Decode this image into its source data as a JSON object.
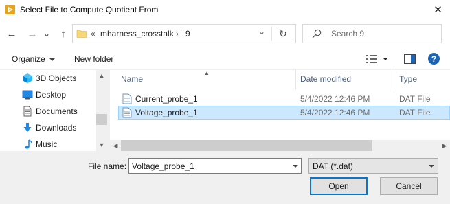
{
  "window": {
    "title": "Select File to Compute Quotient From",
    "close_glyph": "✕",
    "app_icon": "app-logo-icon"
  },
  "navigation": {
    "back_glyph": "←",
    "forward_glyph": "→",
    "recent_glyph": "⌄",
    "up_glyph": "↑",
    "breadcrumb_overflow": "«",
    "breadcrumb": [
      "mharness_crosstalk",
      "9"
    ],
    "breadcrumb_separator": "›",
    "history_glyph": "⌄",
    "refresh_glyph": "↻",
    "search_placeholder": "Search 9"
  },
  "toolbar": {
    "organize_label": "Organize",
    "new_folder_label": "New folder",
    "view_icon": "view-details-icon",
    "preview_icon": "preview-pane-icon",
    "help_glyph": "?"
  },
  "sidebar": {
    "items": [
      {
        "label": "3D Objects",
        "icon": "3d-objects-icon"
      },
      {
        "label": "Desktop",
        "icon": "desktop-icon"
      },
      {
        "label": "Documents",
        "icon": "documents-icon"
      },
      {
        "label": "Downloads",
        "icon": "downloads-icon"
      },
      {
        "label": "Music",
        "icon": "music-icon"
      }
    ]
  },
  "file_list": {
    "columns": [
      "Name",
      "Date modified",
      "Type"
    ],
    "rows": [
      {
        "name": "Current_probe_1",
        "date": "5/4/2022 12:46 PM",
        "type": "DAT File",
        "selected": false
      },
      {
        "name": "Voltage_probe_1",
        "date": "5/4/2022 12:46 PM",
        "type": "DAT File",
        "selected": true
      }
    ]
  },
  "footer": {
    "file_name_label": "File name:",
    "file_name_value": "Voltage_probe_1",
    "file_type_value": "DAT (*.dat)",
    "open_label": "Open",
    "cancel_label": "Cancel"
  },
  "colors": {
    "accent": "#0078d7",
    "selection_bg": "#cce8ff",
    "selection_border": "#99d1ff",
    "help_blue": "#1c64b5",
    "folder_yellow": "#f8d775"
  }
}
